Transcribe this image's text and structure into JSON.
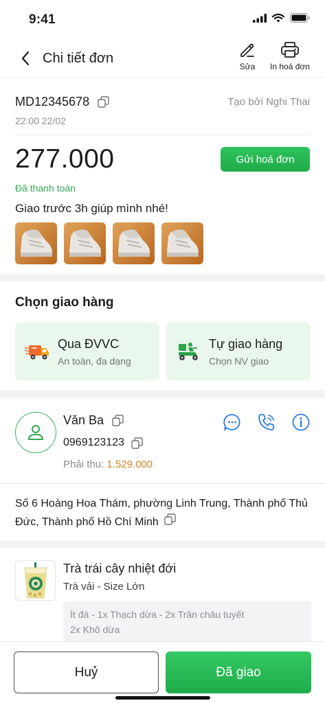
{
  "status_bar": {
    "time": "9:41"
  },
  "nav": {
    "title": "Chi tiết đơn",
    "edit_label": "Sửa",
    "print_label": "In hoá đơn"
  },
  "order": {
    "code": "MD12345678",
    "created_by": "Tạo bởi Nghi Thai",
    "time": "22:00 22/02",
    "amount": "277.000",
    "send_invoice_label": "Gửi hoá đơn",
    "payment_status": "Đã thanh toán",
    "note": "Giao trước 3h giúp mình nhé!",
    "thumbnail_count": 4
  },
  "shipping": {
    "title": "Chọn giao hàng",
    "options": [
      {
        "title": "Qua ĐVVC",
        "subtitle": "An toàn, đa dạng",
        "icon": "delivery-truck-icon"
      },
      {
        "title": "Tự giao hàng",
        "subtitle": "Chọn NV giao",
        "icon": "delivery-scooter-icon"
      }
    ]
  },
  "customer": {
    "name": "Văn Ba",
    "phone": "0969123123",
    "due_label": "Phải thu:",
    "due_value": "1.529.000",
    "address": "Số 6 Hoàng Hoa Thám, phường Linh Trung, Thành phố Thủ Đức, Thành phố Hồ Chí Minh"
  },
  "item": {
    "name": "Trà trái cây nhiệt đới",
    "variant": "Trà vải - Size Lớn",
    "toppings_line1": "Ít đá - 1x Thạch dừa - 2x Trân châu tuyết",
    "toppings_line2": "2x Khô dừa"
  },
  "actions": {
    "cancel_label": "Huỷ",
    "done_label": "Đã giao"
  },
  "colors": {
    "primary_green": "#1faa4a",
    "paid_green": "#2fa84f",
    "due_orange": "#d1832a",
    "action_blue": "#2f7be5",
    "muted_text": "#8a8d93"
  }
}
